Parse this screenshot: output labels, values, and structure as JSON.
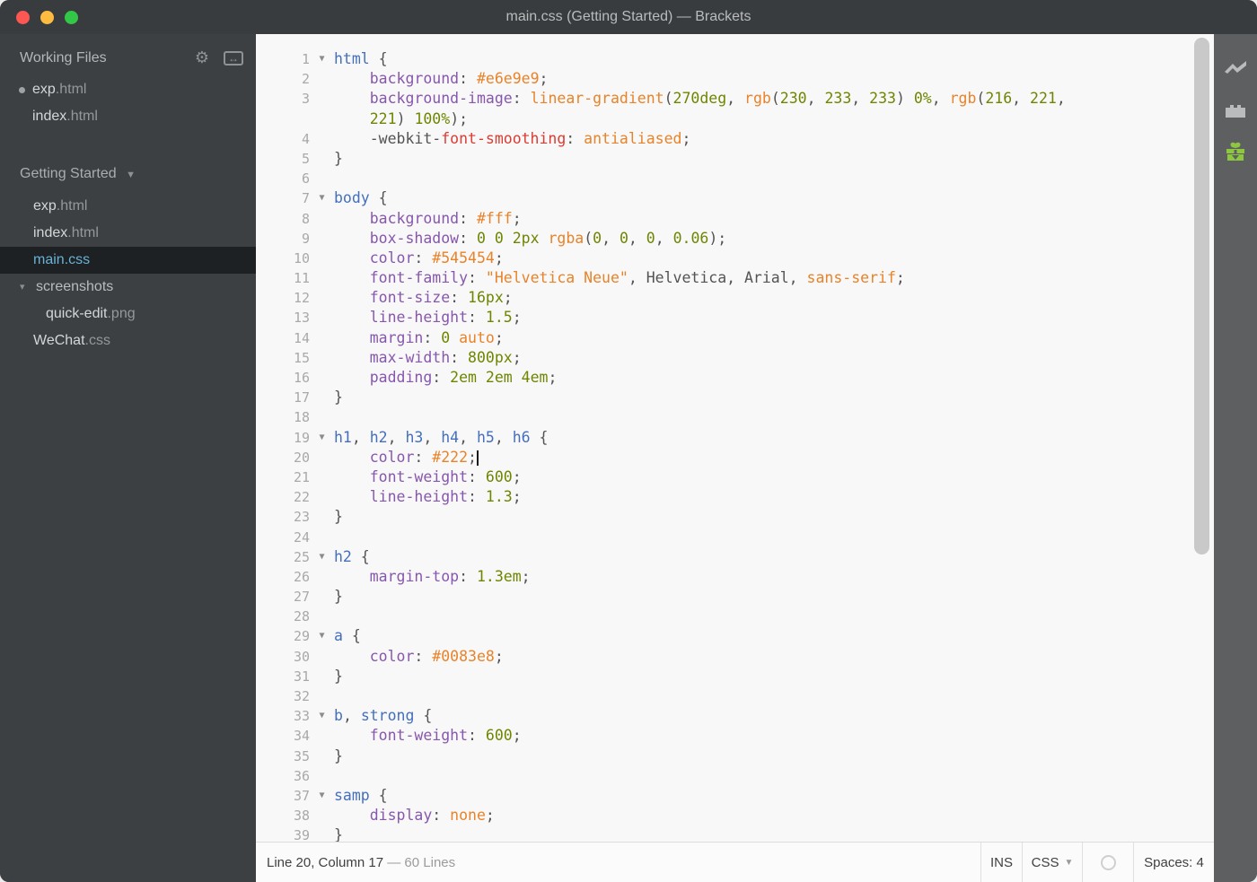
{
  "window": {
    "title": "main.css (Getting Started) — Brackets"
  },
  "traffic_lights": {
    "close": "#fc5753",
    "minimize": "#fdbc40",
    "zoom": "#33c748"
  },
  "sidebar": {
    "working_files": {
      "title": "Working Files",
      "icons": [
        "gear-icon",
        "split-view-icon"
      ],
      "items": [
        {
          "name": "exp",
          "ext": ".html",
          "dirty": true
        },
        {
          "name": "index",
          "ext": ".html",
          "dirty": false
        }
      ]
    },
    "project": {
      "name": "Getting Started"
    },
    "tree": [
      {
        "name": "exp",
        "ext": ".html",
        "type": "file",
        "indent": 1,
        "selected": false
      },
      {
        "name": "index",
        "ext": ".html",
        "type": "file",
        "indent": 1,
        "selected": false
      },
      {
        "name": "main",
        "ext": ".css",
        "type": "file",
        "indent": 1,
        "selected": true
      },
      {
        "name": "screenshots",
        "ext": "",
        "type": "folder",
        "indent": 0,
        "expanded": true
      },
      {
        "name": "quick-edit",
        "ext": ".png",
        "type": "file",
        "indent": 2,
        "selected": false
      },
      {
        "name": "WeChat",
        "ext": ".css",
        "type": "file",
        "indent": 1,
        "selected": false
      }
    ]
  },
  "editor": {
    "rows": [
      {
        "num": "1",
        "fold": true,
        "t": [
          [
            "s",
            "html"
          ],
          [
            "d",
            " {"
          ]
        ]
      },
      {
        "num": "2",
        "fold": false,
        "t": [
          [
            "d",
            "    "
          ],
          [
            "p",
            "background"
          ],
          [
            "d",
            ": "
          ],
          [
            "a",
            "#e6e9e9"
          ],
          [
            "d",
            ";"
          ]
        ]
      },
      {
        "num": "3",
        "fold": false,
        "t": [
          [
            "d",
            "    "
          ],
          [
            "p",
            "background-image"
          ],
          [
            "d",
            ": "
          ],
          [
            "a",
            "linear-gradient"
          ],
          [
            "d",
            "("
          ],
          [
            "n",
            "270deg"
          ],
          [
            "d",
            ", "
          ],
          [
            "a",
            "rgb"
          ],
          [
            "d",
            "("
          ],
          [
            "n",
            "230"
          ],
          [
            "d",
            ", "
          ],
          [
            "n",
            "233"
          ],
          [
            "d",
            ", "
          ],
          [
            "n",
            "233"
          ],
          [
            "d",
            ") "
          ],
          [
            "n",
            "0%"
          ],
          [
            "d",
            ", "
          ],
          [
            "a",
            "rgb"
          ],
          [
            "d",
            "("
          ],
          [
            "n",
            "216"
          ],
          [
            "d",
            ", "
          ],
          [
            "n",
            "221"
          ],
          [
            "d",
            ","
          ]
        ]
      },
      {
        "num": "",
        "fold": false,
        "t": [
          [
            "d",
            "    "
          ],
          [
            "n",
            "221"
          ],
          [
            "d",
            ") "
          ],
          [
            "n",
            "100%"
          ],
          [
            "d",
            ");"
          ]
        ]
      },
      {
        "num": "4",
        "fold": false,
        "t": [
          [
            "d",
            "    -webkit-"
          ],
          [
            "e",
            "font-smoothing"
          ],
          [
            "d",
            ": "
          ],
          [
            "a",
            "antialiased"
          ],
          [
            "d",
            ";"
          ]
        ]
      },
      {
        "num": "5",
        "fold": false,
        "t": [
          [
            "d",
            "}"
          ]
        ]
      },
      {
        "num": "6",
        "fold": false,
        "t": []
      },
      {
        "num": "7",
        "fold": true,
        "t": [
          [
            "s",
            "body"
          ],
          [
            "d",
            " {"
          ]
        ]
      },
      {
        "num": "8",
        "fold": false,
        "t": [
          [
            "d",
            "    "
          ],
          [
            "p",
            "background"
          ],
          [
            "d",
            ": "
          ],
          [
            "a",
            "#fff"
          ],
          [
            "d",
            ";"
          ]
        ]
      },
      {
        "num": "9",
        "fold": false,
        "t": [
          [
            "d",
            "    "
          ],
          [
            "p",
            "box-shadow"
          ],
          [
            "d",
            ": "
          ],
          [
            "n",
            "0"
          ],
          [
            "d",
            " "
          ],
          [
            "n",
            "0"
          ],
          [
            "d",
            " "
          ],
          [
            "n",
            "2px"
          ],
          [
            "d",
            " "
          ],
          [
            "a",
            "rgba"
          ],
          [
            "d",
            "("
          ],
          [
            "n",
            "0"
          ],
          [
            "d",
            ", "
          ],
          [
            "n",
            "0"
          ],
          [
            "d",
            ", "
          ],
          [
            "n",
            "0"
          ],
          [
            "d",
            ", "
          ],
          [
            "n",
            "0.06"
          ],
          [
            "d",
            ");"
          ]
        ]
      },
      {
        "num": "10",
        "fold": false,
        "t": [
          [
            "d",
            "    "
          ],
          [
            "p",
            "color"
          ],
          [
            "d",
            ": "
          ],
          [
            "a",
            "#545454"
          ],
          [
            "d",
            ";"
          ]
        ]
      },
      {
        "num": "11",
        "fold": false,
        "t": [
          [
            "d",
            "    "
          ],
          [
            "p",
            "font-family"
          ],
          [
            "d",
            ": "
          ],
          [
            "a",
            "\"Helvetica Neue\""
          ],
          [
            "d",
            ", Helvetica, Arial, "
          ],
          [
            "a",
            "sans-serif"
          ],
          [
            "d",
            ";"
          ]
        ]
      },
      {
        "num": "12",
        "fold": false,
        "t": [
          [
            "d",
            "    "
          ],
          [
            "p",
            "font-size"
          ],
          [
            "d",
            ": "
          ],
          [
            "n",
            "16px"
          ],
          [
            "d",
            ";"
          ]
        ]
      },
      {
        "num": "13",
        "fold": false,
        "t": [
          [
            "d",
            "    "
          ],
          [
            "p",
            "line-height"
          ],
          [
            "d",
            ": "
          ],
          [
            "n",
            "1.5"
          ],
          [
            "d",
            ";"
          ]
        ]
      },
      {
        "num": "14",
        "fold": false,
        "t": [
          [
            "d",
            "    "
          ],
          [
            "p",
            "margin"
          ],
          [
            "d",
            ": "
          ],
          [
            "n",
            "0"
          ],
          [
            "d",
            " "
          ],
          [
            "a",
            "auto"
          ],
          [
            "d",
            ";"
          ]
        ]
      },
      {
        "num": "15",
        "fold": false,
        "t": [
          [
            "d",
            "    "
          ],
          [
            "p",
            "max-width"
          ],
          [
            "d",
            ": "
          ],
          [
            "n",
            "800px"
          ],
          [
            "d",
            ";"
          ]
        ]
      },
      {
        "num": "16",
        "fold": false,
        "t": [
          [
            "d",
            "    "
          ],
          [
            "p",
            "padding"
          ],
          [
            "d",
            ": "
          ],
          [
            "n",
            "2em"
          ],
          [
            "d",
            " "
          ],
          [
            "n",
            "2em"
          ],
          [
            "d",
            " "
          ],
          [
            "n",
            "4em"
          ],
          [
            "d",
            ";"
          ]
        ]
      },
      {
        "num": "17",
        "fold": false,
        "t": [
          [
            "d",
            "}"
          ]
        ]
      },
      {
        "num": "18",
        "fold": false,
        "t": []
      },
      {
        "num": "19",
        "fold": true,
        "t": [
          [
            "s",
            "h1"
          ],
          [
            "d",
            ", "
          ],
          [
            "s",
            "h2"
          ],
          [
            "d",
            ", "
          ],
          [
            "s",
            "h3"
          ],
          [
            "d",
            ", "
          ],
          [
            "s",
            "h4"
          ],
          [
            "d",
            ", "
          ],
          [
            "s",
            "h5"
          ],
          [
            "d",
            ", "
          ],
          [
            "s",
            "h6"
          ],
          [
            "d",
            " {"
          ]
        ]
      },
      {
        "num": "20",
        "fold": false,
        "t": [
          [
            "d",
            "    "
          ],
          [
            "p",
            "color"
          ],
          [
            "d",
            ": "
          ],
          [
            "a",
            "#222"
          ],
          [
            "d",
            ";"
          ],
          [
            "cur",
            ""
          ]
        ]
      },
      {
        "num": "21",
        "fold": false,
        "t": [
          [
            "d",
            "    "
          ],
          [
            "p",
            "font-weight"
          ],
          [
            "d",
            ": "
          ],
          [
            "n",
            "600"
          ],
          [
            "d",
            ";"
          ]
        ]
      },
      {
        "num": "22",
        "fold": false,
        "t": [
          [
            "d",
            "    "
          ],
          [
            "p",
            "line-height"
          ],
          [
            "d",
            ": "
          ],
          [
            "n",
            "1.3"
          ],
          [
            "d",
            ";"
          ]
        ]
      },
      {
        "num": "23",
        "fold": false,
        "t": [
          [
            "d",
            "}"
          ]
        ]
      },
      {
        "num": "24",
        "fold": false,
        "t": []
      },
      {
        "num": "25",
        "fold": true,
        "t": [
          [
            "s",
            "h2"
          ],
          [
            "d",
            " {"
          ]
        ]
      },
      {
        "num": "26",
        "fold": false,
        "t": [
          [
            "d",
            "    "
          ],
          [
            "p",
            "margin-top"
          ],
          [
            "d",
            ": "
          ],
          [
            "n",
            "1.3em"
          ],
          [
            "d",
            ";"
          ]
        ]
      },
      {
        "num": "27",
        "fold": false,
        "t": [
          [
            "d",
            "}"
          ]
        ]
      },
      {
        "num": "28",
        "fold": false,
        "t": []
      },
      {
        "num": "29",
        "fold": true,
        "t": [
          [
            "s",
            "a"
          ],
          [
            "d",
            " {"
          ]
        ]
      },
      {
        "num": "30",
        "fold": false,
        "t": [
          [
            "d",
            "    "
          ],
          [
            "p",
            "color"
          ],
          [
            "d",
            ": "
          ],
          [
            "a",
            "#0083e8"
          ],
          [
            "d",
            ";"
          ]
        ]
      },
      {
        "num": "31",
        "fold": false,
        "t": [
          [
            "d",
            "}"
          ]
        ]
      },
      {
        "num": "32",
        "fold": false,
        "t": []
      },
      {
        "num": "33",
        "fold": true,
        "t": [
          [
            "s",
            "b"
          ],
          [
            "d",
            ", "
          ],
          [
            "s",
            "strong"
          ],
          [
            "d",
            " {"
          ]
        ]
      },
      {
        "num": "34",
        "fold": false,
        "t": [
          [
            "d",
            "    "
          ],
          [
            "p",
            "font-weight"
          ],
          [
            "d",
            ": "
          ],
          [
            "n",
            "600"
          ],
          [
            "d",
            ";"
          ]
        ]
      },
      {
        "num": "35",
        "fold": false,
        "t": [
          [
            "d",
            "}"
          ]
        ]
      },
      {
        "num": "36",
        "fold": false,
        "t": []
      },
      {
        "num": "37",
        "fold": true,
        "t": [
          [
            "s",
            "samp"
          ],
          [
            "d",
            " {"
          ]
        ]
      },
      {
        "num": "38",
        "fold": false,
        "t": [
          [
            "d",
            "    "
          ],
          [
            "p",
            "display"
          ],
          [
            "d",
            ": "
          ],
          [
            "a",
            "none"
          ],
          [
            "d",
            ";"
          ]
        ]
      },
      {
        "num": "39",
        "fold": false,
        "t": [
          [
            "d",
            "}"
          ]
        ]
      }
    ],
    "syntax_colors": {
      "selector": "#446fbd",
      "property": "#8757ad",
      "number": "#6d8600",
      "atom": "#e8832a",
      "error": "#dc3b32",
      "default": "#535353"
    }
  },
  "statusbar": {
    "cursor_position": "Line 20, Column 17",
    "line_count": "— 60 Lines",
    "overwrite_mode": "INS",
    "language": "CSS",
    "spaces": "Spaces:",
    "spaces_value": "4"
  },
  "toolbar": {
    "icons": [
      "live-preview-icon",
      "extension-manager-icon",
      "extension-update-icon"
    ],
    "update_color": "#8dc63f"
  }
}
